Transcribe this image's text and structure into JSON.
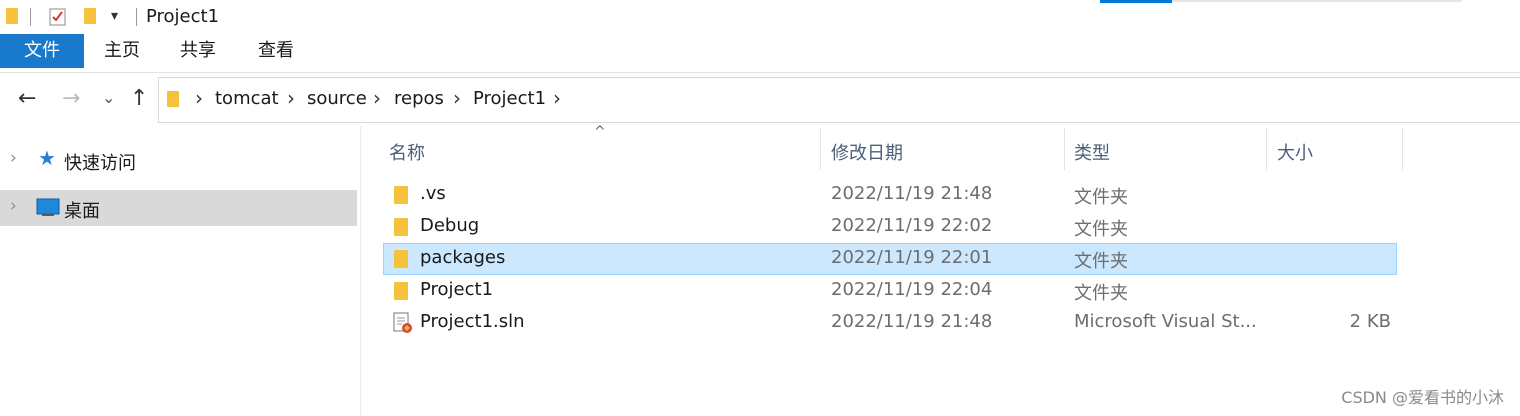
{
  "window": {
    "title": "Project1"
  },
  "quick_access_toolbar": {
    "items": [
      "folder-icon",
      "properties-icon",
      "new-folder-icon",
      "customize-dropdown-icon"
    ]
  },
  "ribbon": {
    "tabs": [
      {
        "label": "文件",
        "active": true
      },
      {
        "label": "主页"
      },
      {
        "label": "共享"
      },
      {
        "label": "查看"
      }
    ]
  },
  "nav": {
    "back": "←",
    "forward": "→",
    "recent": "⌄",
    "up": "↑"
  },
  "address": {
    "crumbs": [
      "tomcat",
      "source",
      "repos",
      "Project1"
    ],
    "separator": "›"
  },
  "navpane": {
    "items": [
      {
        "label": "快速访问",
        "icon": "star-icon"
      },
      {
        "label": "桌面",
        "icon": "desktop-icon",
        "selected": true
      }
    ]
  },
  "filelist": {
    "columns": {
      "name": "名称",
      "date": "修改日期",
      "type": "类型",
      "size": "大小"
    },
    "sort_indicator": "^",
    "rows": [
      {
        "name": ".vs",
        "date": "2022/11/19 21:48",
        "type": "文件夹",
        "size": "",
        "icon": "folder-icon"
      },
      {
        "name": "Debug",
        "date": "2022/11/19 22:02",
        "type": "文件夹",
        "size": "",
        "icon": "folder-icon"
      },
      {
        "name": "packages",
        "date": "2022/11/19 22:01",
        "type": "文件夹",
        "size": "",
        "icon": "folder-icon",
        "selected": true
      },
      {
        "name": "Project1",
        "date": "2022/11/19 22:04",
        "type": "文件夹",
        "size": "",
        "icon": "folder-icon"
      },
      {
        "name": "Project1.sln",
        "date": "2022/11/19 21:48",
        "type": "Microsoft Visual St...",
        "size": "2 KB",
        "icon": "sln-file-icon"
      }
    ]
  },
  "watermark": "CSDN @爱看书的小沐",
  "colors": {
    "accent": "#1979ca",
    "selection": "#cce8ff",
    "folder": "#f5c33b"
  }
}
